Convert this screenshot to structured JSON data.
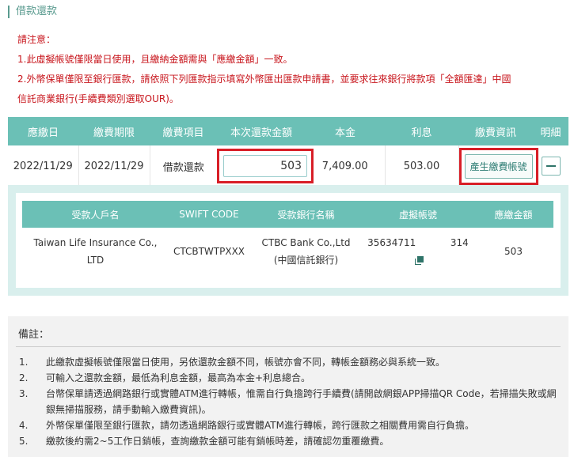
{
  "section_title": "借款還款",
  "notice": {
    "heading": "請注意：",
    "line1": "1.此虛擬帳號僅限當日使用，且繳納金額需與「應繳金額」一致。",
    "line2a": "2.外幣保單僅限至銀行匯款，請依照下列匯款指示填寫外幣匯出匯款申請書，並要求往來銀行將款項「全額匯達」中國",
    "line2b": "信託商業銀行(手續費類別選取OUR)。"
  },
  "main_table": {
    "headers": [
      "應繳日",
      "繳費期限",
      "繳費項目",
      "本次還款金額",
      "本金",
      "利息",
      "繳費資訊",
      "明細"
    ],
    "row": {
      "due_date": "2022/11/29",
      "deadline": "2022/11/29",
      "item": "借款還款",
      "amount": "503",
      "principal": "7,409.00",
      "interest": "503.00",
      "generate_button": "產生繳費帳號"
    }
  },
  "detail_table": {
    "headers": [
      "受款人戶名",
      "SWIFT CODE",
      "受款銀行名稱",
      "虛擬帳號",
      "應繳金額"
    ],
    "row": {
      "payee_line1": "Taiwan Life Insurance Co.,",
      "payee_line2": "LTD",
      "swift": "CTCBTWTPXXX",
      "bank_line1": "CTBC Bank Co.,Ltd",
      "bank_line2": "(中國信託銀行)",
      "account_prefix": "35634711",
      "account_suffix": "314",
      "amount_due": "503"
    }
  },
  "remarks": {
    "title": "備註：",
    "items": [
      {
        "num": "1.",
        "text": "此繳款虛擬帳號僅限當日使用，另依還款金額不同，帳號亦會不同，轉帳金額務必與系統一致。"
      },
      {
        "num": "2.",
        "text": "可輸入之還款金額，最低為利息金額，最高為本金+利息總合。"
      },
      {
        "num": "3.",
        "text": "台幣保單請透過網路銀行或實體ATM進行轉帳，惟需自行負擔跨行手續費(請開啟網銀APP掃描QR Code，若掃描失敗或網銀無掃描服務，請手動輸入繳費資訊)。"
      },
      {
        "num": "4.",
        "text": "外幣保單僅限至銀行匯款，請勿透過網路銀行或實體ATM進行轉帳，跨行匯款之相關費用需自行負擔。"
      },
      {
        "num": "5.",
        "text": "繳款後約需2~5工作日銷帳，查詢繳款金額可能有銷帳時差，請確認勿重覆繳費。"
      }
    ]
  },
  "colors": {
    "header_teal": "#6bc0b6",
    "notice_red": "#c8161d",
    "highlight_red": "#d81e27",
    "panel_bg": "#d9efed"
  }
}
